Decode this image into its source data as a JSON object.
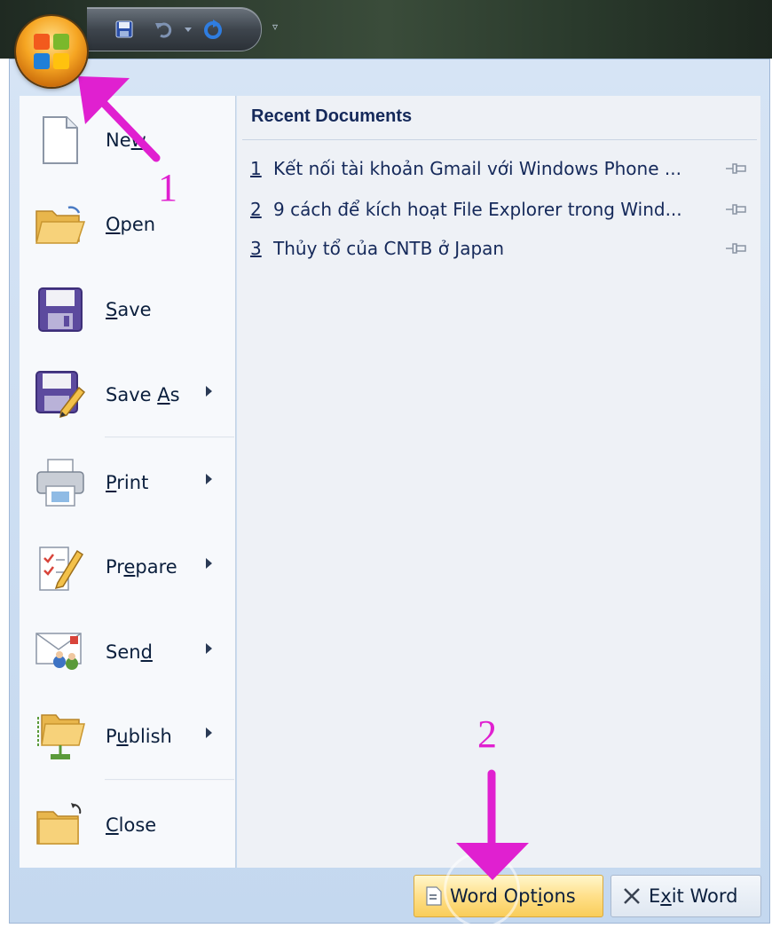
{
  "quick_access": {
    "items": [
      {
        "name": "save-icon"
      },
      {
        "name": "undo-icon"
      },
      {
        "name": "redo-icon"
      }
    ],
    "more_glyph": "▿"
  },
  "menu": {
    "items": [
      {
        "key": "new",
        "label_pre": "Ne",
        "label_ul": "w",
        "label_post": "",
        "has_submenu": false
      },
      {
        "key": "open",
        "label_pre": "",
        "label_ul": "O",
        "label_post": "pen",
        "has_submenu": false
      },
      {
        "key": "save",
        "label_pre": "",
        "label_ul": "S",
        "label_post": "ave",
        "has_submenu": false
      },
      {
        "key": "save-as",
        "label_pre": "Save ",
        "label_ul": "A",
        "label_post": "s",
        "has_submenu": true
      },
      {
        "key": "print",
        "label_pre": "",
        "label_ul": "P",
        "label_post": "rint",
        "has_submenu": true
      },
      {
        "key": "prepare",
        "label_pre": "Pr",
        "label_ul": "e",
        "label_post": "pare",
        "has_submenu": true
      },
      {
        "key": "send",
        "label_pre": "Sen",
        "label_ul": "d",
        "label_post": "",
        "has_submenu": true
      },
      {
        "key": "publish",
        "label_pre": "P",
        "label_ul": "u",
        "label_post": "blish",
        "has_submenu": true
      },
      {
        "key": "close",
        "label_pre": "",
        "label_ul": "C",
        "label_post": "lose",
        "has_submenu": false
      }
    ]
  },
  "recent": {
    "title": "Recent Documents",
    "documents": [
      {
        "num": "1",
        "name": "Kết nối tài khoản Gmail với Windows Phone ..."
      },
      {
        "num": "2",
        "name": "9 cách để kích hoạt File Explorer trong Wind..."
      },
      {
        "num": "3",
        "name": "Thủy tổ của CNTB ở Japan"
      }
    ]
  },
  "buttons": {
    "word_options": {
      "pre": "Word Opt",
      "ul": "i",
      "post": "ons"
    },
    "exit_word": {
      "pre": "E",
      "ul": "x",
      "post": "it Word"
    }
  },
  "annotations": {
    "step1": "1",
    "step2": "2",
    "color": "#e020d0"
  }
}
